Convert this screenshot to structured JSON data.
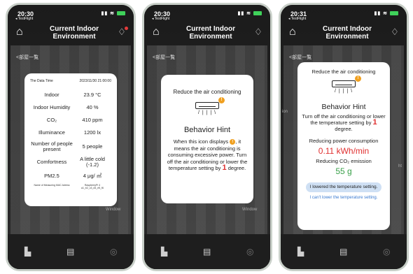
{
  "status": [
    {
      "time": "20:30",
      "sub": "◂ TestFlight"
    },
    {
      "time": "20:30",
      "sub": "◂ TestFlight"
    },
    {
      "time": "20:31",
      "sub": "◂ TestFlight"
    }
  ],
  "header": {
    "title_line1": "Current Indoor",
    "title_line2": "Environment"
  },
  "breadcrumb": "<部屋一覧",
  "background_fragments": {
    "people_right": "ht",
    "window": "Window",
    "small_left": "ion"
  },
  "panel1": {
    "datetime_label": "The Data Time",
    "datetime_value": "2023/11/30 21:00:00",
    "rows": [
      {
        "label": "Indoor",
        "value": "23.9 °C"
      },
      {
        "label": "Indoor Humidity",
        "value": "40 %"
      },
      {
        "label": "CO₂",
        "value": "410 ppm"
      },
      {
        "label": "Illuminance",
        "value": "1200 lx"
      },
      {
        "label": "Number of people present",
        "value": "5 people"
      },
      {
        "label": "Comfortness",
        "value": "A little cold (-1.2)"
      },
      {
        "label": "PM2.5",
        "value": "4 μg/ ㎥"
      }
    ],
    "footer_label": "Name of Measuring MAC Adress",
    "footer_value": "RaspberryPi 4 a1_b2_c3_d4_e5_f6"
  },
  "panel2": {
    "heading": "Reduce the air conditioning",
    "title": "Behavior Hint",
    "body_a": "When this icon displays",
    "body_b": ", it means the air conditioning is consuming excessive power. Turn off the air conditioning or lower the temperature setting by",
    "number": "1",
    "body_c": "degree."
  },
  "panel3": {
    "heading": "Reduce the air conditioning",
    "title": "Behavior Hint",
    "body_a": "Turn off the air conditioning or lower the temperature setting by",
    "number": "1",
    "body_b": "degree.",
    "power_label": "Reducing power consumption",
    "power_value": "0.11 kWh/min",
    "co2_label": "Reducing CO₂ emission",
    "co2_value": "55 g",
    "btn_lowered": "I lowered the temperature setting.",
    "btn_cant": "I can't lower the temperature setting."
  },
  "icons": {
    "home": "home-icon",
    "bulb": "lightbulb-icon",
    "warning": "warning-icon",
    "ac": "air-conditioner-icon",
    "tab1": "building-icon",
    "tab2": "document-icon",
    "tab3": "clock-icon"
  },
  "colors": {
    "accent_red": "#e03030",
    "accent_green": "#3aa04a",
    "warning_orange": "#f0a020",
    "link_blue": "#3a7ad0"
  }
}
